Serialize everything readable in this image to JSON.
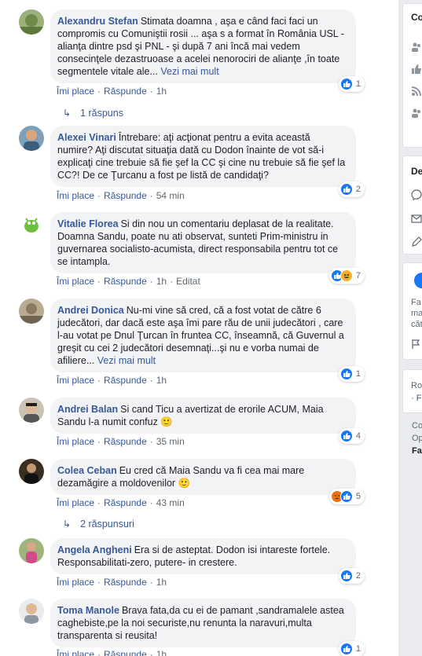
{
  "comments": [
    {
      "author": "Alexandru Stefan",
      "text": "Stimata doamna , aşa e când faci faci un compromis cu Comuniştii rosii ... aşa s a format în România USL - alianţa dintre psd şi PNL - şi după 7 ani încă mai vedem consecinţele dezastruoase a acelei nenorociri de alianţe ,în toate segmentele vitale ale...",
      "more": "Vezi mai mult",
      "like": "Îmi place",
      "reply": "Răspunde",
      "time": "1h",
      "reaction_count": "1"
    },
    {
      "author": "Alexei Vinari",
      "text": "Întrebare: aţi acţionat pentru a evita această numire? Aţi discutat situaţia dată cu Dodon înainte de vot să-i explicaţi cine trebuie să fie şef la CC şi cine nu trebuie să fie şef la CC?! De ce Ţurcanu a fost pe listă de candidaţi?",
      "like": "Îmi place",
      "reply": "Răspunde",
      "time": "54 min",
      "reaction_count": "2"
    },
    {
      "author": "Vitalie Florea",
      "text": "Si din nou un comentariu deplasat de la realitate. Doamna Sandu, poate nu ati observat, sunteti Prim-ministru in guvernarea socialisto-acumista, direct responsabila pentru tot ce se intampla.",
      "like": "Îmi place",
      "reply": "Răspunde",
      "time": "1h",
      "edited": "Editat",
      "reaction_count": "7"
    },
    {
      "author": "Andrei Donica",
      "text": "Nu-mi vine să cred, că a fost votat de către 6 judecători, dar dacă este aşa îmi pare rău de unii judecători , care l-au votat pe Dnul Ţurcan în fruntea CC, înseamnă, că Guvernul a greşit cu cei 2 judecători desemnaţi...şi nu e vorba numai de afiliere...",
      "more": "Vezi mai mult",
      "like": "Îmi place",
      "reply": "Răspunde",
      "time": "1h",
      "reaction_count": "1"
    },
    {
      "author": "Andrei Balan",
      "text": "Si cand Ticu a avertizat de erorile ACUM, Maia Sandu l-a numit confuz",
      "emoji": "🙂",
      "like": "Îmi place",
      "reply": "Răspunde",
      "time": "35 min",
      "reaction_count": "4"
    },
    {
      "author": "Colea Ceban",
      "text": "Eu cred că Maia Sandu va fi cea mai mare dezamăgire a moldovenilor",
      "emoji": "🙂",
      "like": "Îmi place",
      "reply": "Răspunde",
      "time": "43 min",
      "reaction_count": "5"
    },
    {
      "author": "Angela Angheni",
      "text": "Era si de asteptat. Dodon isi intareste fortele. Responsabilitati-zero, putere- in crestere.",
      "like": "Îmi place",
      "reply": "Răspunde",
      "time": "1h",
      "reaction_count": "2"
    },
    {
      "author": "Toma Manole",
      "text": "Brava fata,da cu ei de pamant ,sandramalele astea caghebiste,pe la noi securiste,nu renunta la naravuri,multa transparenta si reusita!",
      "like": "Îmi place",
      "reply": "Răspunde",
      "time": "1h",
      "reaction_count": "1"
    }
  ],
  "replies": [
    {
      "label": "1 răspuns"
    },
    {
      "label": "2 răspunsuri"
    }
  ],
  "sidebar": {
    "top_label": "Co",
    "section2": "De",
    "card_text_1": "Fa",
    "card_text_2": "ma",
    "card_text_3": "căt",
    "ro": "Ro",
    "dot_f": "· F",
    "co": "Co",
    "op": "Op",
    "fa": "Fa"
  },
  "colors": {
    "link": "#385898",
    "bubble": "#f2f3f5",
    "like": "#1877f2",
    "page_bg": "#e9ebee"
  }
}
